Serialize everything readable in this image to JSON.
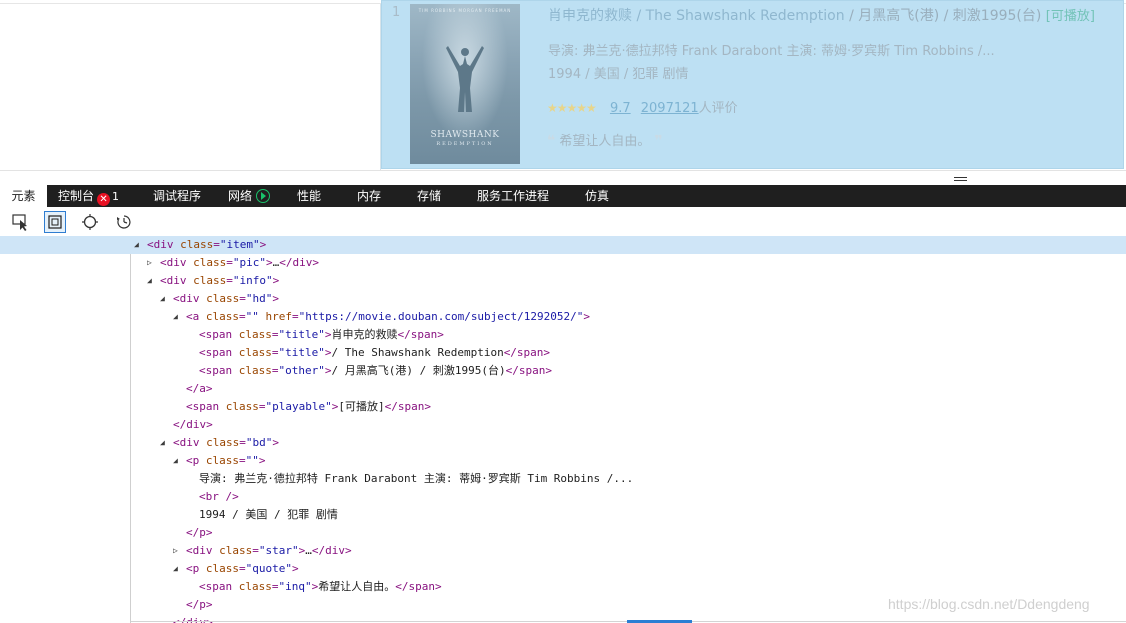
{
  "movie": {
    "rank": "1",
    "poster_title": "SHAWSHANK",
    "poster_subtitle": "REDEMPTION",
    "poster_top": "TIM ROBBINS  MORGAN FREEMAN",
    "title_cn": "肖申克的救赎",
    "title_en": " / The Shawshank Redemption",
    "other": " / 月黑高飞(港) / 刺激1995(台)",
    "playable": "[可播放]",
    "director_line": "导演: 弗兰克·德拉邦特 Frank Darabont   主演: 蒂姆·罗宾斯 Tim Robbins /...",
    "meta_line": "1994 / 美国 / 犯罪 剧情",
    "stars": "★★★★★",
    "rating": "9.7",
    "votes": "2097121",
    "votes_suffix": "人评价",
    "quote": "希望让人自由。",
    "quote_open": "❝",
    "quote_close": "❞"
  },
  "devtools": {
    "tabs": [
      {
        "label": "元素"
      },
      {
        "label": "控制台"
      },
      {
        "label": "调试程序"
      },
      {
        "label": "网络"
      },
      {
        "label": "性能"
      },
      {
        "label": "内存"
      },
      {
        "label": "存储"
      },
      {
        "label": "服务工作进程"
      },
      {
        "label": "仿真"
      }
    ],
    "error_count": "1",
    "error_icon": "✕"
  },
  "tree": {
    "l0": {
      "tag": "div",
      "an": "class",
      "av": "item"
    },
    "l1": {
      "tag": "div",
      "an": "class",
      "av": "pic",
      "ellipsis": "…"
    },
    "l2": {
      "tag": "div",
      "an": "class",
      "av": "info"
    },
    "l3": {
      "tag": "div",
      "an": "class",
      "av": "hd"
    },
    "l4": {
      "tag": "a",
      "an": "class",
      "av": "",
      "an2": "href",
      "av2": "https://movie.douban.com/subject/1292052/"
    },
    "l5": {
      "tag": "span",
      "an": "class",
      "av": "title",
      "text": "肖申克的救赎"
    },
    "l6": {
      "tag": "span",
      "an": "class",
      "av": "title",
      "text": "/ The Shawshank Redemption"
    },
    "l7": {
      "tag": "span",
      "an": "class",
      "av": "other",
      "text": "/ 月黑高飞(港) / 刺激1995(台)"
    },
    "l8": {
      "close": "</a>"
    },
    "l9": {
      "tag": "span",
      "an": "class",
      "av": "playable",
      "text": "[可播放]"
    },
    "l10": {
      "close": "</div>"
    },
    "l11": {
      "tag": "div",
      "an": "class",
      "av": "bd"
    },
    "l12": {
      "tag": "p",
      "an": "class",
      "av": ""
    },
    "l13": {
      "text": "导演: 弗兰克·德拉邦特 Frank Darabont   主演: 蒂姆·罗宾斯 Tim Robbins /..."
    },
    "l14": {
      "br": "<br />"
    },
    "l15": {
      "text": "1994 / 美国 / 犯罪 剧情"
    },
    "l16": {
      "close": "</p>"
    },
    "l17": {
      "tag": "div",
      "an": "class",
      "av": "star",
      "ellipsis": "…"
    },
    "l18": {
      "tag": "p",
      "an": "class",
      "av": "quote"
    },
    "l19": {
      "tag": "span",
      "an": "class",
      "av": "inq",
      "text": "希望让人自由。"
    },
    "l20": {
      "close": "</p>"
    },
    "l21": {
      "close": "</div>"
    }
  },
  "watermark": "https://blog.csdn.net/Ddengdeng",
  "colors": {
    "highlight": "#bde0f3",
    "tabbar": "#1f1f1f",
    "tag": "#881280",
    "attr_name": "#994500",
    "attr_value": "#1a1aa6",
    "selected_row": "#cfe5f7"
  }
}
